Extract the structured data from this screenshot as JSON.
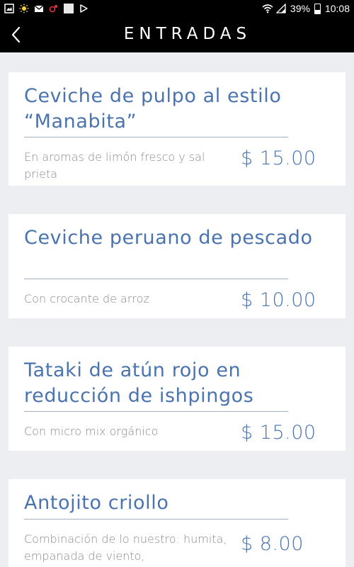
{
  "status_bar": {
    "battery_percent": "39%",
    "time": "10:08",
    "icons": [
      "gallery-icon",
      "weather-icon",
      "gmail-icon",
      "app-icon",
      "notification-icon",
      "play-store-icon",
      "wifi-icon",
      "signal-icon",
      "battery-icon"
    ]
  },
  "header": {
    "title": "ENTRADAS",
    "back_icon": "chevron-left-icon"
  },
  "colors": {
    "accent": "#4a74b0",
    "header_bg": "#000000",
    "page_bg": "#eceef1",
    "card_bg": "#ffffff",
    "description": "#8a8a8a"
  },
  "items": [
    {
      "name": "Ceviche de pulpo al estilo “Manabita”",
      "description": "En aromas de limón fresco y sal prieta",
      "price": "$ 15.00"
    },
    {
      "name": "Ceviche peruano de pescado",
      "description": "Con crocante de arroz",
      "price": "$ 10.00"
    },
    {
      "name": "Tataki de atún rojo en reducción de ishpingos",
      "description": "Con micro mix orgánico",
      "price": "$ 15.00"
    },
    {
      "name": "Antojito criollo",
      "description": "Combinación de lo nuestro: humita, empanada de viento,",
      "price": "$ 8.00"
    }
  ]
}
